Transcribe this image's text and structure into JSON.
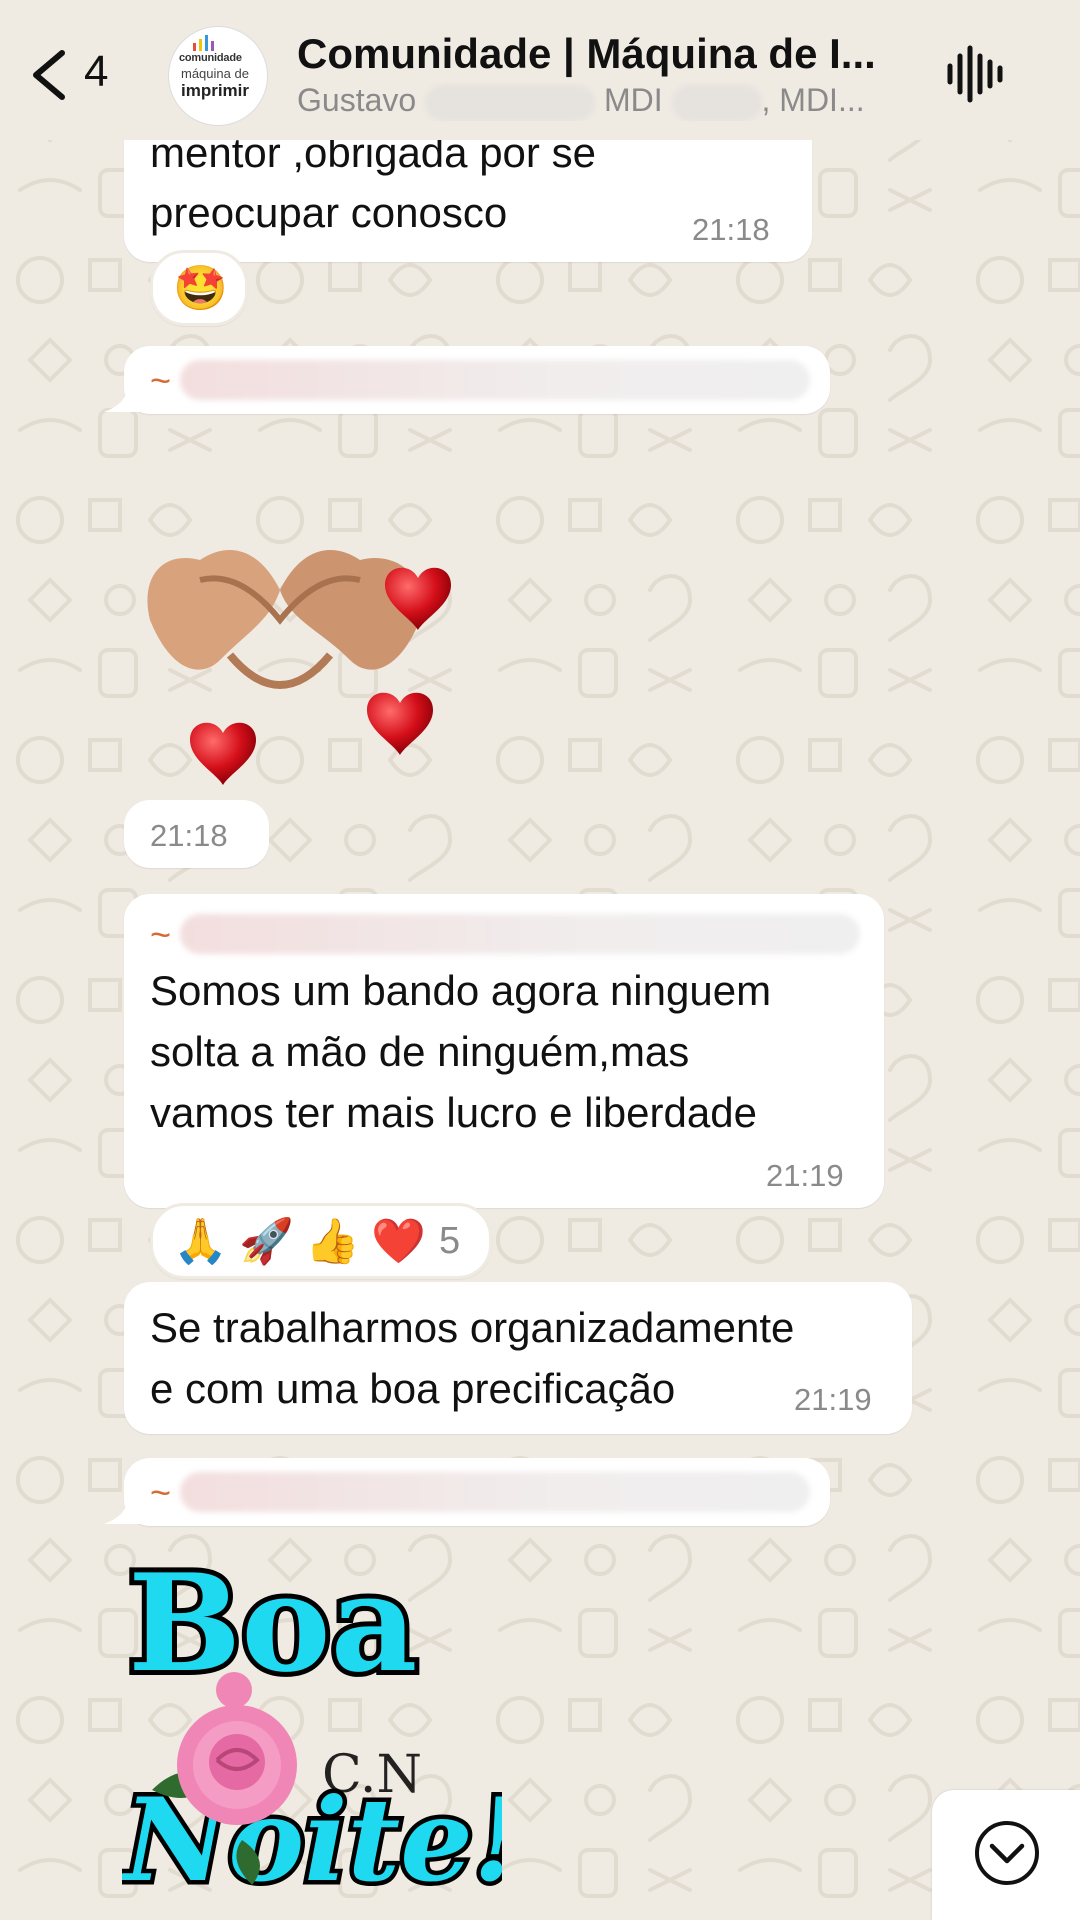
{
  "header": {
    "unread_count": "4",
    "title": "Comunidade | Máquina de I...",
    "subtitle_first": "Gustavo",
    "subtitle_second": "MDI",
    "subtitle_third": ", MDI...",
    "avatar_line1": "comunidade",
    "avatar_line2": "máquina de",
    "avatar_line3": "imprimir"
  },
  "messages": {
    "m1_line1": "mentor ,obrigada por se",
    "m1_line2": "preocupar conosco",
    "m1_time": "21:18",
    "m1_reaction": "🤩",
    "sender_tilde": "~",
    "sticker_time": "21:18",
    "m3_line1": "Somos um bando agora ninguem",
    "m3_line2": "solta a mão de ninguém,mas",
    "m3_line3": "vamos ter mais lucro e liberdade",
    "m3_time": "21:19",
    "m3_reactions": [
      "🙏",
      "🚀",
      "👍",
      "❤️"
    ],
    "m3_reaction_count": "5",
    "m4_line1": "Se trabalharmos organizadamente",
    "m4_line2": "e com uma boa precificação",
    "m4_time": "21:19",
    "sticker2_word1": "Boa",
    "sticker2_word2": "Noite!",
    "sticker2_mark": "C.N"
  },
  "colors": {
    "wallpaper": "#efeae2",
    "bubble": "#ffffff",
    "sender_name": "#d36b33",
    "timestamp": "#8a8a8a",
    "sticker_text": "#1fd9f0"
  },
  "icons": [
    "chevron-left-icon",
    "waveform-icon",
    "chevron-down-icon"
  ]
}
